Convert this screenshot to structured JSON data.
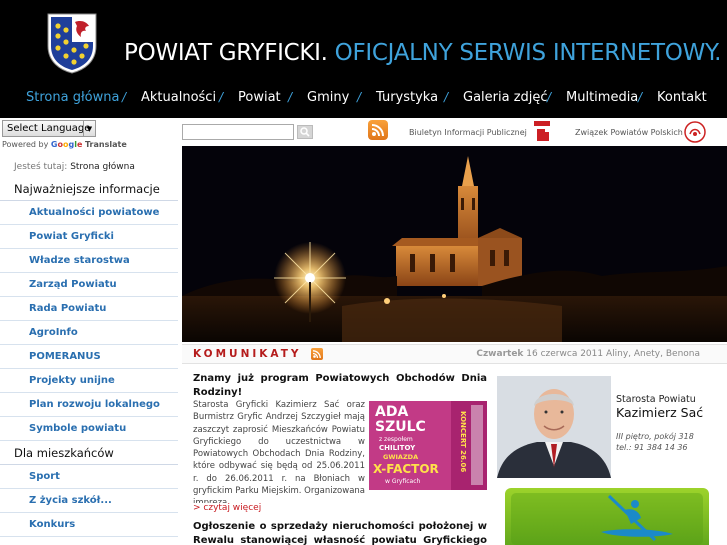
{
  "header": {
    "title_main": "POWIAT GRYFICKI.",
    "title_sub": "OFICJALNY SERWIS INTERNETOWY."
  },
  "nav": {
    "items": [
      {
        "label": "Strona główna"
      },
      {
        "label": "Aktualności"
      },
      {
        "label": "Powiat"
      },
      {
        "label": "Gminy"
      },
      {
        "label": "Turystyka"
      },
      {
        "label": "Galeria zdjęć"
      },
      {
        "label": "Multimedia"
      },
      {
        "label": "Kontakt"
      }
    ],
    "separator": "/"
  },
  "translate": {
    "select_label": "Select Language",
    "powered_by": "Powered by",
    "translate_word": "Translate",
    "google_letters": [
      "G",
      "o",
      "o",
      "g",
      "l",
      "e"
    ]
  },
  "breadcrumb": {
    "prefix": "Jesteś tutaj:",
    "current": "Strona główna"
  },
  "sidebar": {
    "section1": "Najważniejsze informacje",
    "items1": [
      {
        "label": "Aktualności powiatowe"
      },
      {
        "label": "Powiat Gryficki"
      },
      {
        "label": "Władze starostwa"
      },
      {
        "label": "Zarząd Powiatu"
      },
      {
        "label": "Rada Powiatu"
      },
      {
        "label": "AgroInfo"
      },
      {
        "label": "POMERANUS"
      },
      {
        "label": "Projekty unijne"
      },
      {
        "label": "Plan rozwoju lokalnego"
      },
      {
        "label": "Symbole powiatu"
      }
    ],
    "section2": "Dla mieszkańców",
    "items2": [
      {
        "label": "Sport"
      },
      {
        "label": "Z życia szkół..."
      },
      {
        "label": "Konkurs"
      }
    ]
  },
  "topbar": {
    "bip_label": "Biuletyn Informacji Publicznej",
    "zpp_label": "Związek Powiatów Polskich"
  },
  "news": {
    "heading": "KOMUNIKATY",
    "date_day": "Czwartek",
    "date": "16 czerwca 2011",
    "namedays": "Aliny, Anety, Benona"
  },
  "articles": [
    {
      "title": "Znamy już program Powiatowych Obchodów Dnia Rodziny!",
      "body": "Starosta Gryficki Kazimierz Sać oraz Burmistrz Gryfic Andrzej Szczygieł mają zaszczyt zaprosić Mieszkańców Powiatu Gryfickiego do uczestnictwa w Powiatowych Obchodach Dnia Rodziny, które odbywać się będą od 25.06.2011 r. do 26.06.2011 r. na Błoniach w gryfickim Parku Miejskim. Organizowana impreza ...",
      "more": "> czytaj więcej",
      "thumb": {
        "line1": "ADA",
        "line2": "SZULC",
        "line3": "z zespołem",
        "line4": "CHILITOY",
        "line5": "GWIAZDA",
        "line6": "X-FACTOR",
        "line7": "w Gryficach",
        "side": "KONCERT 26.06"
      }
    },
    {
      "title": "Ogłoszenie o sprzedaży nieruchomości położonej w Rewalu stanowiącej własność powiatu Gryfickiego"
    }
  ],
  "starosta": {
    "role": "Starosta Powiatu",
    "name": "Kazimierz Sać",
    "room": "III piętro, pokój 318",
    "tel": "tel.: 91 384 14 36"
  },
  "colors": {
    "header_bg": "#000000",
    "accent_blue": "#3fa3dc",
    "menu_blue": "#2a6fb0",
    "news_red": "#b51c1c"
  }
}
